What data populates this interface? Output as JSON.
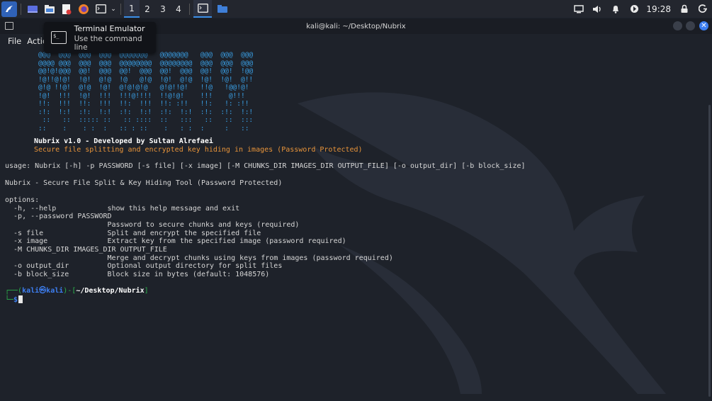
{
  "taskbar": {
    "workspaces": [
      "1",
      "2",
      "3",
      "4"
    ],
    "active_workspace": "1",
    "clock": "19:28"
  },
  "window": {
    "title": "kali@kali: ~/Desktop/Nubrix",
    "close_glyph": "✕"
  },
  "menu": {
    "items": [
      "File",
      "Actio"
    ]
  },
  "tooltip": {
    "title": "Terminal Emulator",
    "subtitle": "Use the command line"
  },
  "terminal": {
    "banner": [
      "@@@  @@@  @@@  @@@  @@@@@@@   @@@@@@@   @@@  @@@  @@@",
      "@@@@ @@@  @@@  @@@  @@@@@@@@  @@@@@@@@  @@@  @@@  @@@",
      "@@!@!@@@  @@!  @@@  @@!  @@@  @@!  @@@  @@!  @@!  !@@",
      "!@!!@!@!  !@!  @!@  !@   @!@  !@!  @!@  !@!  !@!  @!!",
      "@!@ !!@!  @!@  !@!  @!@!@!@   @!@!!@!   !!@   !@@!@!",
      "!@!  !!!  !@!  !!!  !!!@!!!!  !!@!@!    !!!    @!!!",
      "!!:  !!!  !!:  !!!  !!:  !!!  !!: :!!   !!:   !: :!!",
      ":!:  !:!  :!:  !:!  :!:  !:!  :!:  !:!  :!:  :!:  !:!",
      " ::   ::  ::::: ::   :: ::::  ::   :::   ::   ::  :::",
      "::    :    : :  :   :: : ::    :   : :  :     :   ::"
    ],
    "title_line": "Nubrix v1.0 - Developed by Sultan Alrefaei",
    "subtitle_line": "Secure file splitting and encrypted key hiding in images (Password Protected)",
    "usage": "usage: Nubrix [-h] -p PASSWORD [-s file] [-x image] [-M CHUNKS_DIR IMAGES_DIR OUTPUT_FILE] [-o output_dir] [-b block_size]",
    "description": "Nubrix - Secure File Split & Key Hiding Tool (Password Protected)",
    "options_header": "options:",
    "options": [
      "  -h, --help            show this help message and exit",
      "  -p, --password PASSWORD",
      "                        Password to secure chunks and keys (required)",
      "  -s file               Split and encrypt the specified file",
      "  -x image              Extract key from the specified image (password required)",
      "  -M CHUNKS_DIR IMAGES_DIR OUTPUT_FILE",
      "                        Merge and decrypt chunks using keys from images (password required)",
      "  -o output_dir         Optional output directory for split files",
      "  -b block_size         Block size in bytes (default: 1048576)"
    ],
    "prompt": {
      "open": "┌──(",
      "user": "kali㉿kali",
      "mid": ")-[",
      "path": "~/Desktop/Nubrix",
      "close": "]",
      "second": "└─",
      "dollar": "$"
    }
  },
  "colors": {
    "banner": "#3aa0e6",
    "title": "#ffffff",
    "subtitle": "#e8943a",
    "prompt_green": "#2bb24c",
    "prompt_blue": "#3d7ef0",
    "accent": "#3a8ee6"
  }
}
